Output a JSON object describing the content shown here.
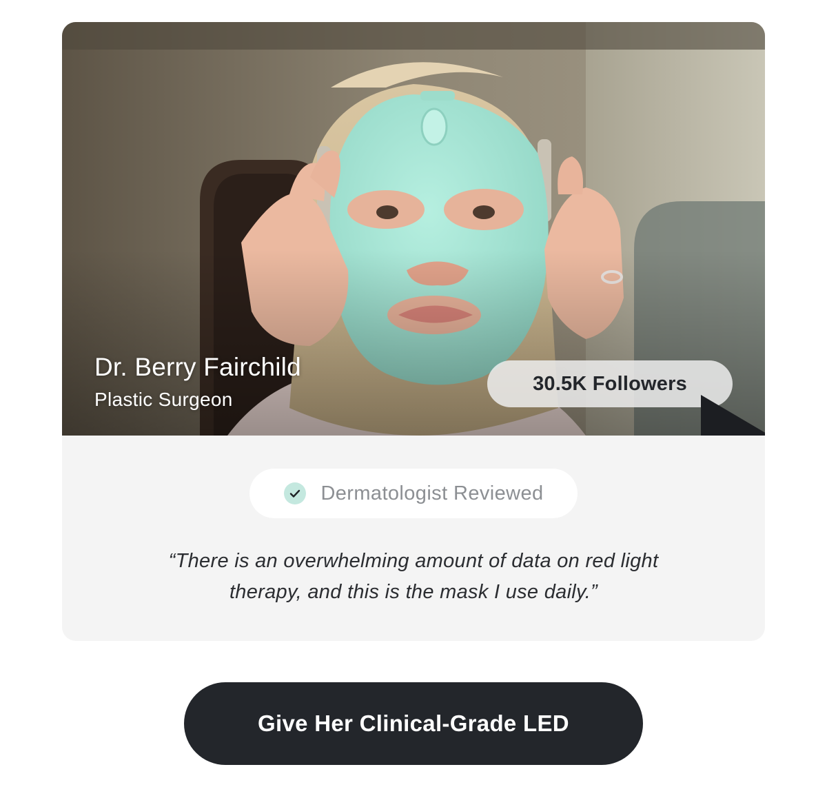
{
  "testimonial": {
    "name": "Dr. Berry Fairchild",
    "title": "Plastic Surgeon",
    "followers_label": "30.5K Followers",
    "badge_label": "Dermatologist Reviewed",
    "quote_line1": "“There is an overwhelming amount of data on red light",
    "quote_line2": "therapy, and this is the mask I use daily.”"
  },
  "cta": {
    "label": "Give Her Clinical-Grade LED"
  },
  "icons": {
    "followers": "play-icon",
    "badge": "check-circle-icon"
  },
  "colors": {
    "mask": "#a8e6d6",
    "button_bg": "#23262b",
    "panel_bg": "#f4f4f4",
    "check_circle": "#c4e8df"
  }
}
